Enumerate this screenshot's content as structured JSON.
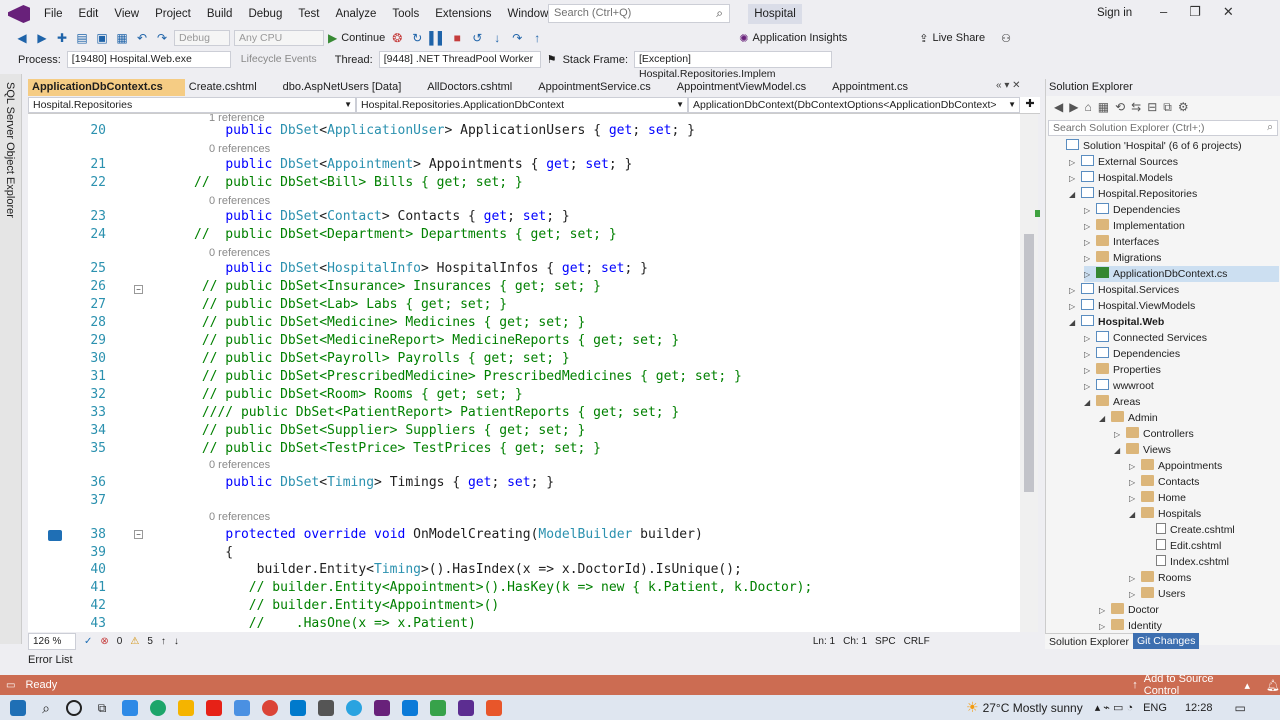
{
  "menubar": {
    "items": [
      "File",
      "Edit",
      "View",
      "Project",
      "Build",
      "Debug",
      "Test",
      "Analyze",
      "Tools",
      "Extensions",
      "Window",
      "Help"
    ],
    "search_placeholder": "Search (Ctrl+Q)",
    "solution_name": "Hospital",
    "signin": "Sign in"
  },
  "toolbar": {
    "config": "Debug",
    "platform": "Any CPU",
    "continue_label": "Continue",
    "app_insights": "Application Insights",
    "live_share": "Live Share"
  },
  "debugbar": {
    "process_label": "Process:",
    "process_value": "[19480] Hospital.Web.exe",
    "lifecycle": "Lifecycle Events",
    "thread_label": "Thread:",
    "thread_value": "[9448] .NET ThreadPool Worker",
    "stackframe_label": "Stack Frame:",
    "stackframe_value": "[Exception] Hospital.Repositories.Implem"
  },
  "sidestrip": "SQL Server Object Explorer",
  "tabs": [
    {
      "label": "ApplicationDbContext.cs",
      "active": true
    },
    {
      "label": "Create.cshtml",
      "active": false
    },
    {
      "label": "dbo.AspNetUsers [Data]",
      "active": false
    },
    {
      "label": "AllDoctors.cshtml",
      "active": false
    },
    {
      "label": "AppointmentService.cs",
      "active": false
    },
    {
      "label": "AppointmentViewModel.cs",
      "active": false
    },
    {
      "label": "Appointment.cs",
      "active": false
    }
  ],
  "navbar": {
    "project": "Hospital.Repositories",
    "type": "Hospital.Repositories.ApplicationDbContext",
    "member": "ApplicationDbContext(DbContextOptions<ApplicationDbContext>"
  },
  "code": [
    {
      "ref": "1 reference"
    },
    {
      "n": "20",
      "html": "    <span class='kw'>public</span> <span class='ty'>DbSet</span>&lt;<span class='ty'>ApplicationUser</span>&gt; ApplicationUsers { <span class='kw'>get</span>; <span class='kw'>set</span>; }"
    },
    {
      "ref": "0 references"
    },
    {
      "n": "21",
      "html": "    <span class='kw'>public</span> <span class='ty'>DbSet</span>&lt;<span class='ty'>Appointment</span>&gt; Appointments { <span class='kw'>get</span>; <span class='kw'>set</span>; }"
    },
    {
      "n": "22",
      "html": "<span class='cm'>//  public DbSet&lt;Bill&gt; Bills { get; set; }</span>"
    },
    {
      "ref": "0 references"
    },
    {
      "n": "23",
      "html": "    <span class='kw'>public</span> <span class='ty'>DbSet</span>&lt;<span class='ty'>Contact</span>&gt; Contacts { <span class='kw'>get</span>; <span class='kw'>set</span>; }"
    },
    {
      "n": "24",
      "html": "<span class='cm'>//  public DbSet&lt;Department&gt; Departments { get; set; }</span>"
    },
    {
      "ref": "0 references"
    },
    {
      "n": "25",
      "html": "    <span class='kw'>public</span> <span class='ty'>DbSet</span>&lt;<span class='ty'>HospitalInfo</span>&gt; HospitalInfos { <span class='kw'>get</span>; <span class='kw'>set</span>; }"
    },
    {
      "n": "26",
      "html": " <span class='cm'>// public DbSet&lt;Insurance&gt; Insurances { get; set; }</span>"
    },
    {
      "n": "27",
      "html": " <span class='cm'>// public DbSet&lt;Lab&gt; Labs { get; set; }</span>"
    },
    {
      "n": "28",
      "html": " <span class='cm'>// public DbSet&lt;Medicine&gt; Medicines { get; set; }</span>"
    },
    {
      "n": "29",
      "html": " <span class='cm'>// public DbSet&lt;MedicineReport&gt; MedicineReports { get; set; }</span>"
    },
    {
      "n": "30",
      "html": " <span class='cm'>// public DbSet&lt;Payroll&gt; Payrolls { get; set; }</span>"
    },
    {
      "n": "31",
      "html": " <span class='cm'>// public DbSet&lt;PrescribedMedicine&gt; PrescribedMedicines { get; set; }</span>"
    },
    {
      "n": "32",
      "html": " <span class='cm'>// public DbSet&lt;Room&gt; Rooms { get; set; }</span>"
    },
    {
      "n": "33",
      "html": " <span class='cm'>//// public DbSet&lt;PatientReport&gt; PatientReports { get; set; }</span>"
    },
    {
      "n": "34",
      "html": " <span class='cm'>// public DbSet&lt;Supplier&gt; Suppliers { get; set; }</span>"
    },
    {
      "n": "35",
      "html": " <span class='cm'>// public DbSet&lt;TestPrice&gt; TestPrices { get; set; }</span>"
    },
    {
      "ref": "0 references"
    },
    {
      "n": "36",
      "html": "    <span class='kw'>public</span> <span class='ty'>DbSet</span>&lt;<span class='ty'>Timing</span>&gt; Timings { <span class='kw'>get</span>; <span class='kw'>set</span>; }"
    },
    {
      "n": "37",
      "html": ""
    },
    {
      "ref": "0 references"
    },
    {
      "n": "38",
      "html": "    <span class='kw'>protected</span> <span class='kw'>override</span> <span class='kw'>void</span> OnModelCreating(<span class='ty'>ModelBuilder</span> builder)"
    },
    {
      "n": "39",
      "html": "    {"
    },
    {
      "n": "40",
      "html": "        builder.Entity&lt;<span class='ty'>Timing</span>&gt;().HasIndex(x =&gt; x.DoctorId).IsUnique();"
    },
    {
      "n": "41",
      "html": "       <span class='cm'>// builder.Entity&lt;Appointment&gt;().HasKey(k =&gt; new { k.Patient, k.Doctor);</span>"
    },
    {
      "n": "42",
      "html": "       <span class='cm'>// builder.Entity&lt;Appointment&gt;()</span>"
    },
    {
      "n": "43",
      "html": "       <span class='cm'>//    .HasOne(x =&gt; x.Patient)</span>"
    }
  ],
  "editor_status": {
    "zoom": "126 %",
    "errors": "0",
    "warnings": "5",
    "line": "Ln: 1",
    "col": "Ch: 1",
    "spc": "SPC",
    "crlf": "CRLF"
  },
  "error_list": "Error List",
  "solution_explorer": {
    "title": "Solution Explorer",
    "search_placeholder": "Search Solution Explorer (Ctrl+;)",
    "tree": [
      {
        "label": "Solution 'Hospital' (6 of 6 projects)",
        "depth": 0,
        "icon": "solution",
        "exp": ""
      },
      {
        "label": "External Sources",
        "depth": 1,
        "icon": "proj",
        "exp": "▷"
      },
      {
        "label": "Hospital.Models",
        "depth": 1,
        "icon": "proj",
        "exp": "▷"
      },
      {
        "label": "Hospital.Repositories",
        "depth": 1,
        "icon": "proj",
        "exp": "◢"
      },
      {
        "label": "Dependencies",
        "depth": 2,
        "icon": "dep",
        "exp": "▷"
      },
      {
        "label": "Implementation",
        "depth": 2,
        "icon": "folder",
        "exp": "▷"
      },
      {
        "label": "Interfaces",
        "depth": 2,
        "icon": "folder",
        "exp": "▷"
      },
      {
        "label": "Migrations",
        "depth": 2,
        "icon": "folder",
        "exp": "▷"
      },
      {
        "label": "ApplicationDbContext.cs",
        "depth": 2,
        "icon": "cs",
        "exp": "▷",
        "selected": true
      },
      {
        "label": "Hospital.Services",
        "depth": 1,
        "icon": "proj",
        "exp": "▷"
      },
      {
        "label": "Hospital.ViewModels",
        "depth": 1,
        "icon": "proj",
        "exp": "▷"
      },
      {
        "label": "Hospital.Web",
        "depth": 1,
        "icon": "proj",
        "exp": "◢",
        "bold": true
      },
      {
        "label": "Connected Services",
        "depth": 2,
        "icon": "dep",
        "exp": "▷"
      },
      {
        "label": "Dependencies",
        "depth": 2,
        "icon": "dep",
        "exp": "▷"
      },
      {
        "label": "Properties",
        "depth": 2,
        "icon": "folder",
        "exp": "▷"
      },
      {
        "label": "wwwroot",
        "depth": 2,
        "icon": "globe",
        "exp": "▷"
      },
      {
        "label": "Areas",
        "depth": 2,
        "icon": "folder",
        "exp": "◢"
      },
      {
        "label": "Admin",
        "depth": 3,
        "icon": "folder",
        "exp": "◢"
      },
      {
        "label": "Controllers",
        "depth": 4,
        "icon": "folder",
        "exp": "▷"
      },
      {
        "label": "Views",
        "depth": 4,
        "icon": "folder",
        "exp": "◢"
      },
      {
        "label": "Appointments",
        "depth": 5,
        "icon": "folder",
        "exp": "▷"
      },
      {
        "label": "Contacts",
        "depth": 5,
        "icon": "folder",
        "exp": "▷"
      },
      {
        "label": "Home",
        "depth": 5,
        "icon": "folder",
        "exp": "▷"
      },
      {
        "label": "Hospitals",
        "depth": 5,
        "icon": "folder",
        "exp": "◢"
      },
      {
        "label": "Create.cshtml",
        "depth": 6,
        "icon": "file",
        "exp": ""
      },
      {
        "label": "Edit.cshtml",
        "depth": 6,
        "icon": "file",
        "exp": ""
      },
      {
        "label": "Index.cshtml",
        "depth": 6,
        "icon": "file",
        "exp": ""
      },
      {
        "label": "Rooms",
        "depth": 5,
        "icon": "folder",
        "exp": "▷"
      },
      {
        "label": "Users",
        "depth": 5,
        "icon": "folder",
        "exp": "▷"
      },
      {
        "label": "Doctor",
        "depth": 3,
        "icon": "folder",
        "exp": "▷"
      },
      {
        "label": "Identity",
        "depth": 3,
        "icon": "folder",
        "exp": "▷"
      }
    ],
    "bottom_tabs": [
      "Solution Explorer",
      "Git Changes"
    ]
  },
  "statusbar": {
    "ready": "Ready",
    "source_control": "Add to Source Control"
  },
  "taskbar": {
    "weather": "27°C  Mostly sunny",
    "lang": "ENG",
    "time": "12:28"
  }
}
